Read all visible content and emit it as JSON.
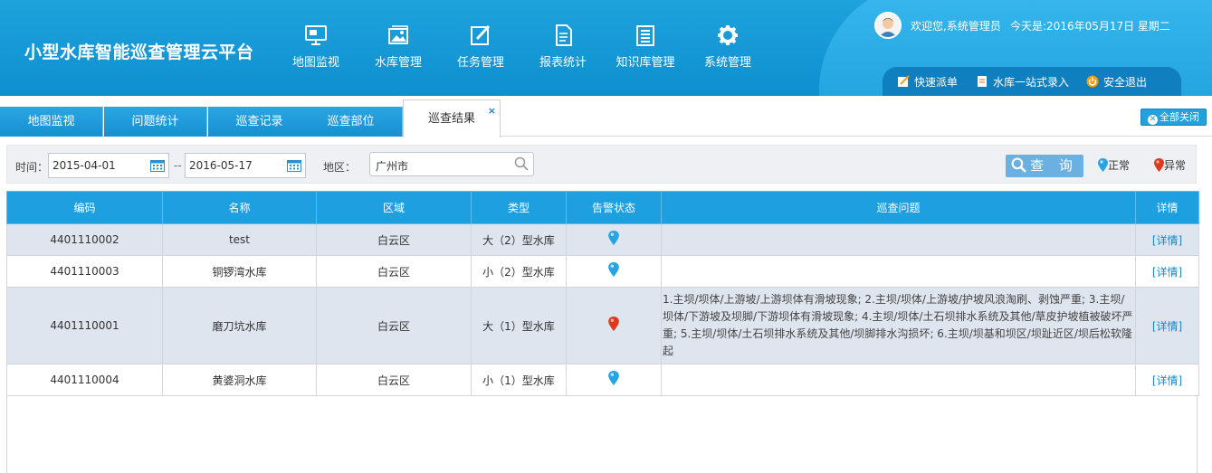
{
  "app": {
    "title": "小型水库智能巡查管理云平台"
  },
  "nav": [
    {
      "label": "地图监视",
      "icon": "monitor-icon"
    },
    {
      "label": "水库管理",
      "icon": "image-icon"
    },
    {
      "label": "任务管理",
      "icon": "edit-icon"
    },
    {
      "label": "报表统计",
      "icon": "document-icon"
    },
    {
      "label": "知识库管理",
      "icon": "list-icon"
    },
    {
      "label": "系统管理",
      "icon": "gear-icon"
    }
  ],
  "user": {
    "welcome": "欢迎您,系统管理员",
    "date": "今天是:2016年05月17日 星期二"
  },
  "quick": {
    "dispatch": "快速派单",
    "entry": "水库一站式录入",
    "logout": "安全退出"
  },
  "tabs": [
    {
      "label": "地图监视"
    },
    {
      "label": "问题统计"
    },
    {
      "label": "巡查记录"
    },
    {
      "label": "巡查部位"
    },
    {
      "label": "巡查结果",
      "close": "×"
    }
  ],
  "close_all": "全部关闭",
  "filters": {
    "time_label": "时间：",
    "start_date": "2015-04-01",
    "separator": "--",
    "end_date": "2016-05-17",
    "area_label": "地区：",
    "area_value": "广州市",
    "query": "查 询",
    "legend_normal": "正常",
    "legend_abnormal": "异常"
  },
  "colors": {
    "normal": "#29a3e2",
    "abnormal": "#e03a1e",
    "header": "#1ea0e0"
  },
  "table": {
    "headers": [
      "编码",
      "名称",
      "区域",
      "类型",
      "告警状态",
      "巡查问题",
      "详情"
    ],
    "rows": [
      {
        "code": "4401110002",
        "name": "test",
        "area": "白云区",
        "type": "大（2）型水库",
        "status": "normal",
        "problem": "",
        "detail": "[详情]"
      },
      {
        "code": "4401110003",
        "name": "铜锣湾水库",
        "area": "白云区",
        "type": "小（2）型水库",
        "status": "normal",
        "problem": "",
        "detail": "[详情]"
      },
      {
        "code": "4401110001",
        "name": "磨刀坑水库",
        "area": "白云区",
        "type": "大（1）型水库",
        "status": "abnormal",
        "problem": "1.主坝/坝体/上游坡/上游坝体有滑坡现象; 2.主坝/坝体/上游坡/护坡风浪淘刷、剥蚀严重; 3.主坝/坝体/下游坡及坝脚/下游坝体有滑坡现象; 4.主坝/坝体/土石坝排水系统及其他/草皮护坡植被破坏严重; 5.主坝/坝体/土石坝排水系统及其他/坝脚排水沟损坏; 6.主坝/坝基和坝区/坝趾近区/坝后松软隆起",
        "detail": "[详情]"
      },
      {
        "code": "4401110004",
        "name": "黄婆洞水库",
        "area": "白云区",
        "type": "小（1）型水库",
        "status": "normal",
        "problem": "",
        "detail": "[详情]"
      }
    ]
  }
}
